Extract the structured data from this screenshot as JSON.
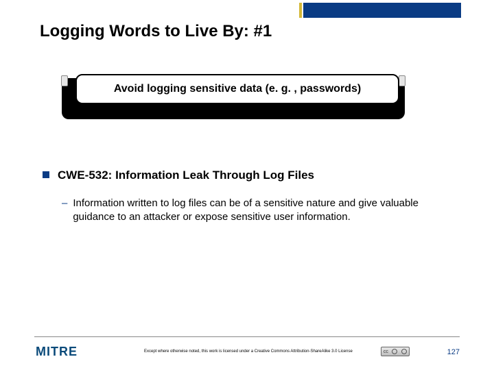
{
  "title": "Logging Words to Live By: #1",
  "callout": "Avoid logging sensitive data (e. g. , passwords)",
  "bullet": "CWE-532: Information Leak Through Log Files",
  "subbullet": "Information written to log files can be of a sensitive nature and give valuable guidance to an attacker or expose sensitive user information.",
  "logo": "MITRE",
  "license": "Except where otherwise noted, this work is licensed under a Creative Commons Attribution-ShareAlike 3.0 License",
  "cc": "cc",
  "page": "127"
}
